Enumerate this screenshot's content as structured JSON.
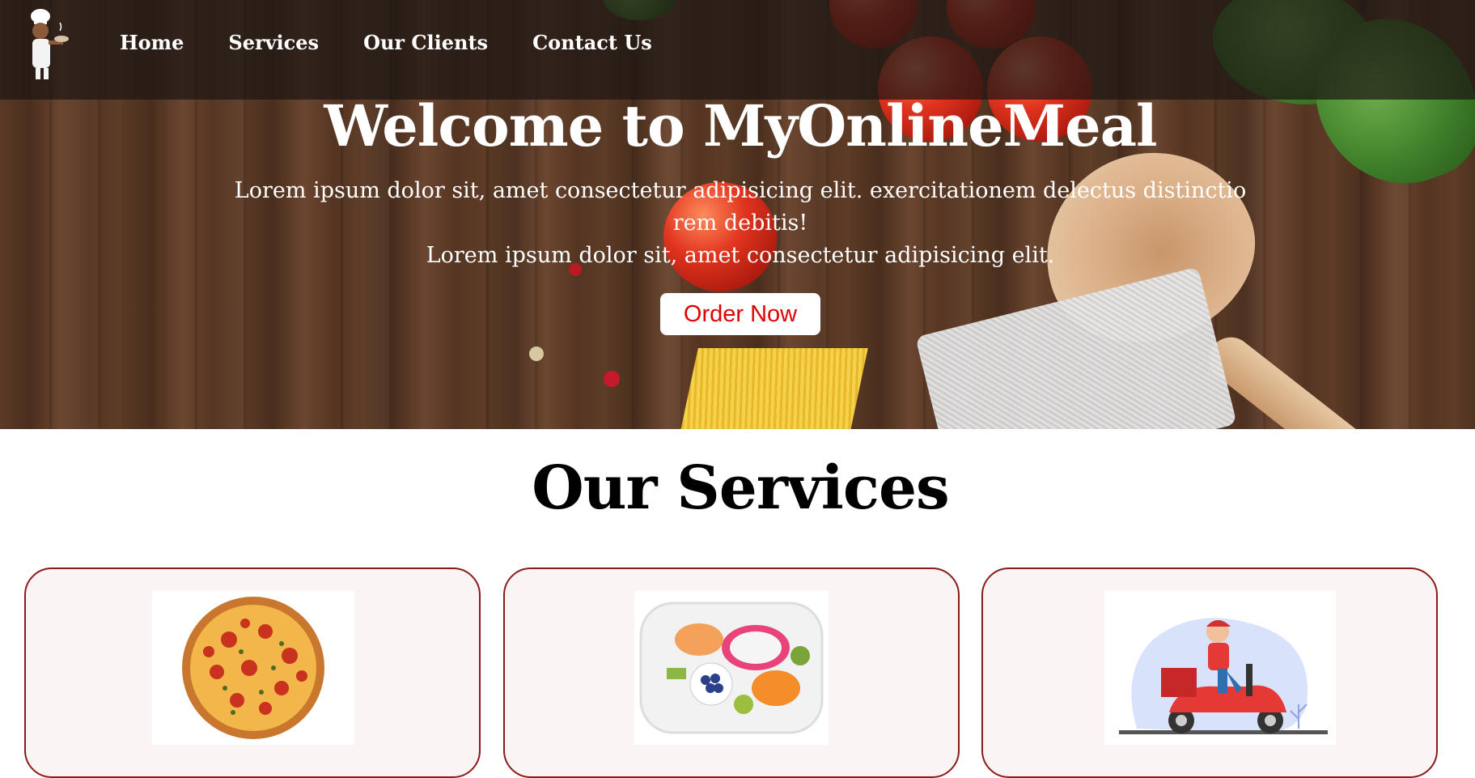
{
  "nav": {
    "logo_alt": "chef-logo",
    "links": [
      "Home",
      "Services",
      "Our Clients",
      "Contact Us"
    ]
  },
  "hero": {
    "title": "Welcome to MyOnlineMeal",
    "paragraph_1": "Lorem ipsum dolor sit, amet consectetur adipisicing elit. exercitationem delectus distinctio rem debitis!",
    "paragraph_2": "Lorem ipsum dolor sit, amet consectetur adipisicing elit.",
    "button_label": "Order Now"
  },
  "services": {
    "title": "Our Services",
    "cards": [
      {
        "image": "pizza-image"
      },
      {
        "image": "fruit-platter-image"
      },
      {
        "image": "delivery-scooter-image"
      }
    ]
  },
  "colors": {
    "nav_overlay": "#1c1614",
    "button_text": "#e00000",
    "card_border": "#8b1a1a",
    "card_bg": "#fbf4f4"
  }
}
